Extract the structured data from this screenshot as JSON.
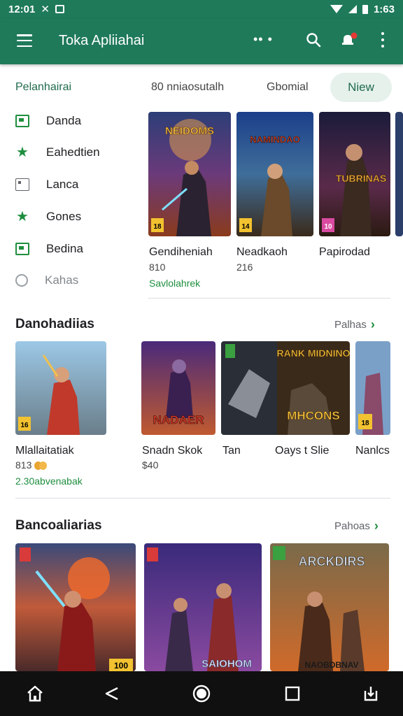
{
  "status_bar": {
    "time_left": "12:01",
    "time_right": "1:63"
  },
  "app_bar": {
    "title": "Toka Apliiahai",
    "loader": "•• •"
  },
  "filters": {
    "title": "Pelanhairai",
    "chips": [
      "80 nniaosutalh",
      "Gbomial"
    ],
    "new_chip": "Niew"
  },
  "side_menu": [
    {
      "label": "Danda",
      "icon": "screen-icon"
    },
    {
      "label": "Eahedtien",
      "icon": "star-icon"
    },
    {
      "label": "Lanca",
      "icon": "dotted-box-icon"
    },
    {
      "label": "Gones",
      "icon": "star-icon"
    },
    {
      "label": "Bedina",
      "icon": "screen-icon"
    },
    {
      "label": "Kahas",
      "icon": "circle-icon"
    }
  ],
  "featured": [
    {
      "title": "Gendiheniah",
      "price": "810",
      "note": "Savlolahrek",
      "art_text": "NEIDOMS",
      "badge": "18"
    },
    {
      "title": "Neadkaoh",
      "price": "216",
      "art_text": "NAMINDAO",
      "badge": "14"
    },
    {
      "title": "Papirodad",
      "art_text": "TUBRINAS",
      "badge": "10"
    }
  ],
  "section2": {
    "title": "Danohadiias",
    "more": "Palhas",
    "cards": [
      {
        "title": "Mlallaitatiak",
        "price": "813",
        "note": "2.30abvenabak",
        "badge": "16"
      },
      {
        "title": "Snadn Skok",
        "price": "$40",
        "art_text": "NADAER"
      },
      {
        "title": "Tan",
        "art_text": ""
      },
      {
        "title": "Oays t Slie",
        "art_text_top": "RANK MIDNINO",
        "art_text_bottom": "MHCONS"
      },
      {
        "title": "Nanlcs",
        "badge": "18"
      }
    ]
  },
  "section3": {
    "title": "Bancoaliarias",
    "more": "Pahoas",
    "cards": [
      {
        "art_text": "",
        "badge": "100"
      },
      {
        "art_text": "SAIOHOM"
      },
      {
        "art_text": "ARCKDIRS",
        "art_text_bottom": "NAOBDBNAV"
      }
    ]
  },
  "colors": {
    "primary": "#1f7a5a",
    "accent": "#1e8e3e",
    "chip_bg": "#e6f1ec"
  }
}
